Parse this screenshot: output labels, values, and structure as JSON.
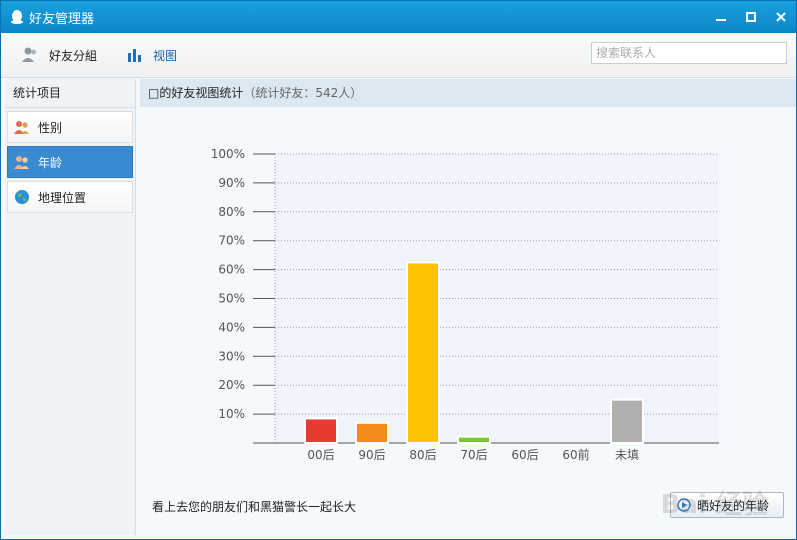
{
  "window": {
    "title": "好友管理器"
  },
  "toolbar": {
    "group_label": "好友分組",
    "view_label": "视图",
    "search_placeholder": "搜索联系人"
  },
  "sidebar": {
    "header": "统计项目",
    "items": [
      {
        "label": "性别"
      },
      {
        "label": "年龄"
      },
      {
        "label": "地理位置"
      }
    ]
  },
  "main": {
    "title": "□的好友视图统计",
    "subtitle": "（统计好友：542人）"
  },
  "chart_data": {
    "type": "bar",
    "categories": [
      "00后",
      "90后",
      "80后",
      "70后",
      "60后",
      "60前",
      "未填"
    ],
    "values": [
      8.5,
      7,
      62.5,
      2.2,
      0,
      0,
      15
    ],
    "colors": [
      "#e83a33",
      "#f48a1a",
      "#fcc300",
      "#7ac82c",
      "#cccccc",
      "#cccccc",
      "#b0b0b0"
    ],
    "yticks": [
      "10%",
      "20%",
      "30%",
      "40%",
      "50%",
      "60%",
      "70%",
      "80%",
      "90%",
      "100%"
    ],
    "ylim": [
      0,
      100
    ],
    "grid": true
  },
  "footer": {
    "text": "看上去您的朋友们和黑猫警长一起长大",
    "share_label": "晒好友的年龄"
  },
  "watermark": {
    "text": "Bai 经验"
  }
}
